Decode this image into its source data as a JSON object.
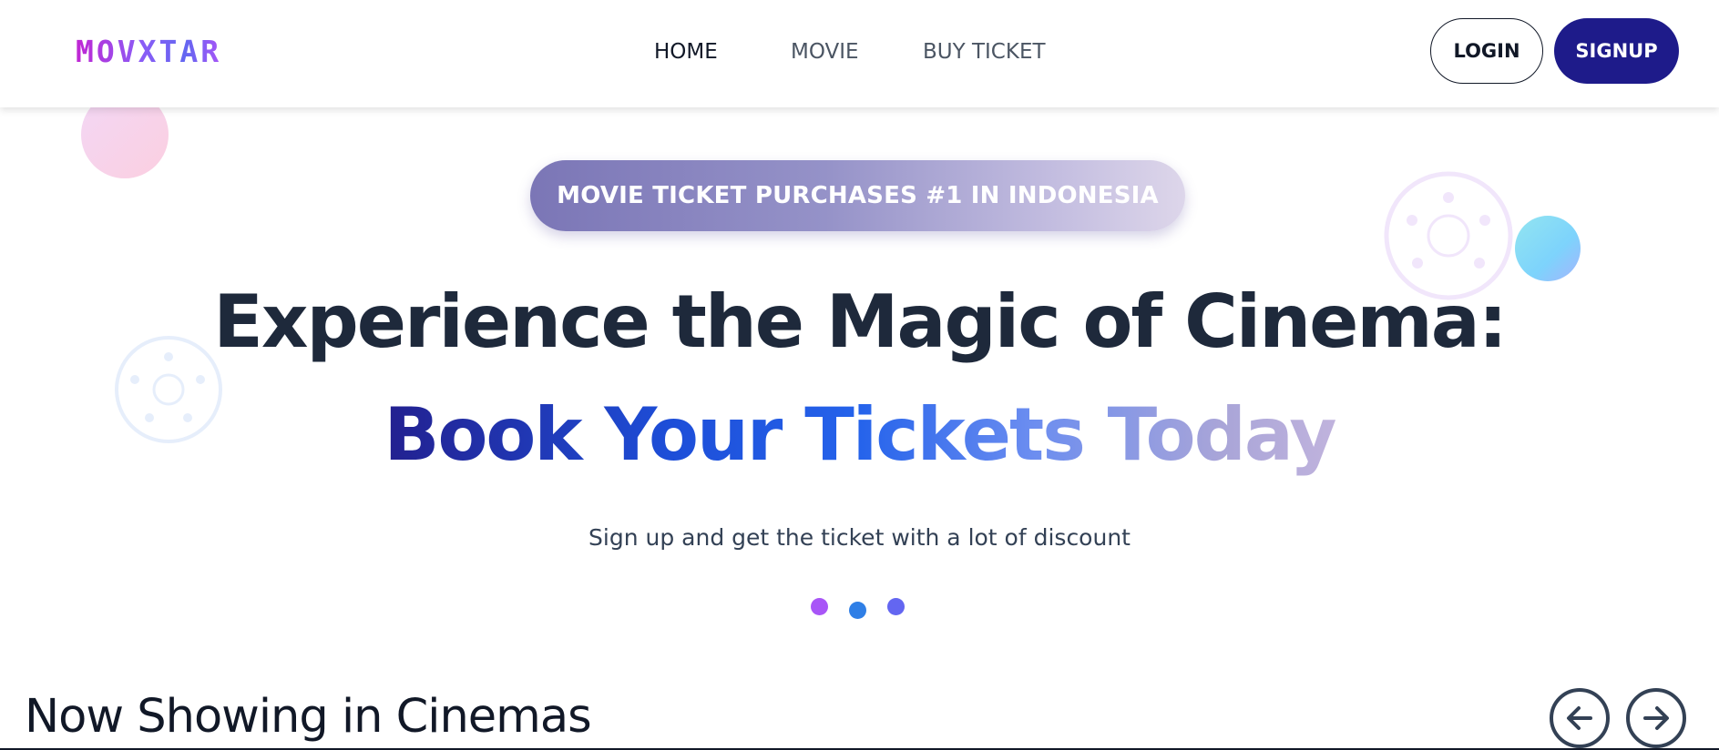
{
  "brand": {
    "logo_text": "MOVXTAR"
  },
  "nav": {
    "links": [
      {
        "label": "HOME",
        "active": true
      },
      {
        "label": "MOVIE",
        "active": false
      },
      {
        "label": "BUY TICKET",
        "active": false
      }
    ],
    "login_label": "LOGIN",
    "signup_label": "SIGNUP"
  },
  "hero": {
    "badge": "MOVIE TICKET PURCHASES #1 IN INDONESIA",
    "title": "Experience the Magic of Cinema:",
    "subtitle": "Book Your Tickets Today",
    "tagline": "Sign up and get the ticket with a lot of discount",
    "carousel_dots": 3,
    "active_dot": 1
  },
  "now_showing": {
    "title": "Now Showing in Cinemas",
    "prev_icon": "arrow-left-circle-icon",
    "next_icon": "arrow-right-circle-icon"
  },
  "colors": {
    "primary": "#1e1b8a",
    "dark_text": "#1e293b",
    "dot_purple": "#a855f7",
    "dot_blue": "#2f7fe6",
    "dot_indigo": "#6366f1"
  }
}
